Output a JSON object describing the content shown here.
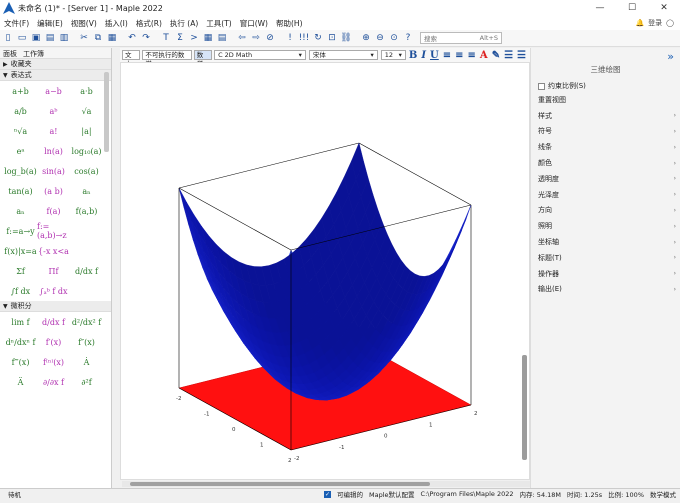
{
  "window": {
    "title": "未命名 (1)* - [Server 1] - Maple 2022",
    "minimize": "—",
    "maximize": "☐",
    "close": "✕"
  },
  "menu": {
    "items": [
      "文件(F)",
      "编辑(E)",
      "视图(V)",
      "插入(I)",
      "格式(R)",
      "执行 (A)",
      "工具(T)",
      "窗口(W)",
      "帮助(H)"
    ],
    "bell_icon": "bell-icon",
    "login": "登录"
  },
  "toolbar": {
    "search_placeholder": "搜索",
    "search_shortcut": "Alt+S"
  },
  "left_panel": {
    "tabs": [
      "面板",
      "工作簿"
    ],
    "favorites": "收藏夹",
    "expressions": "表达式",
    "calculus": "微积分",
    "expr_cells": [
      "a+b",
      "a−b",
      "a·b",
      "a/b",
      "aᵇ",
      "√a",
      "ⁿ√a",
      "a!",
      "|a|",
      "eᵃ",
      "ln(a)",
      "log₁₀(a)",
      "log_b(a)",
      "sin(a)",
      "cos(a)",
      "tan(a)",
      "(a b)",
      "aₙ",
      "aₙ",
      "f(a)",
      "f(a,b)",
      "f:=a→y",
      "f:=(a,b)→z",
      "",
      "f(x)|x=a",
      "{-x x<a",
      "",
      "Σf",
      "Πf",
      "d/dx f",
      "∫f dx",
      "∫ₐᵇ f dx",
      ""
    ],
    "calc_cells": [
      "lim f",
      "d/dx f",
      "d²/dx² f",
      "dⁿ/dxⁿ f",
      "f′(x)",
      "f″(x)",
      "f‴(x)",
      "f⁽ⁿ⁾(x)",
      "Ȧ",
      "Ä",
      "∂/∂x f",
      "∂²f"
    ]
  },
  "format_bar": {
    "text_btn": "文本",
    "nonexec_btn": "不可执行的数学",
    "math_btn": "数学",
    "mode": "C  2D Math",
    "font": "宋体",
    "size": "12",
    "bold": "B",
    "italic": "I",
    "underline": "U"
  },
  "plot": {
    "x_ticks": [
      "-2",
      "-1",
      "0",
      "1",
      "2"
    ],
    "y_ticks": [
      "-2",
      "-1",
      "0",
      "1",
      "2"
    ],
    "surface_color": "#0a12a8",
    "plane_color": "#ff1010",
    "function": "x^2 + y^2",
    "z_range": [
      0,
      8
    ]
  },
  "right_panel": {
    "title": "三维绘图",
    "collapse": "»",
    "lock_aspect": "约束比例(S)",
    "rows": [
      "重置视图",
      "样式",
      "符号",
      "线条",
      "颜色",
      "透明度",
      "光泽度",
      "方向",
      "照明",
      "坐标轴",
      "标题(T)",
      "操作器",
      "输出(E)"
    ]
  },
  "status": {
    "ready": "待机",
    "editable": "可编辑的",
    "profile": "Maple默认配置",
    "path": "C:\\Program Files\\Maple 2022",
    "memory": "内存: 54.18M",
    "time": "时间: 1.25s",
    "zoom": "比例: 100%",
    "mode": "数学模式"
  }
}
